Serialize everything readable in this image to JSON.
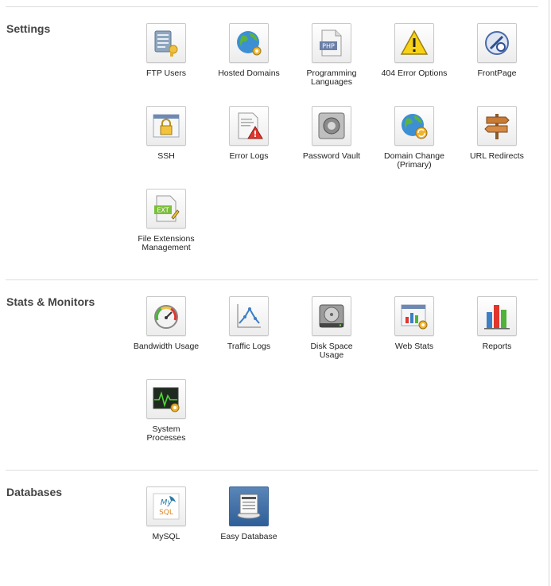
{
  "sections": [
    {
      "title": "Settings",
      "items": [
        {
          "label": "FTP Users",
          "icon": "ftp-users-icon"
        },
        {
          "label": "Hosted Domains",
          "icon": "hosted-domains-icon"
        },
        {
          "label": "Programming\nLanguages",
          "icon": "php-file-icon"
        },
        {
          "label": "404 Error Options",
          "icon": "warning-icon"
        },
        {
          "label": "FrontPage",
          "icon": "frontpage-icon"
        },
        {
          "label": "SSH",
          "icon": "ssh-lock-icon"
        },
        {
          "label": "Error Logs",
          "icon": "error-log-icon"
        },
        {
          "label": "Password Vault",
          "icon": "vault-icon"
        },
        {
          "label": "Domain Change\n(Primary)",
          "icon": "domain-change-icon"
        },
        {
          "label": "URL Redirects",
          "icon": "signpost-icon"
        },
        {
          "label": "File Extensions\nManagement",
          "icon": "file-extension-icon"
        }
      ]
    },
    {
      "title": "Stats & Monitors",
      "items": [
        {
          "label": "Bandwidth Usage",
          "icon": "gauge-icon"
        },
        {
          "label": "Traffic Logs",
          "icon": "traffic-chart-icon"
        },
        {
          "label": "Disk Space\nUsage",
          "icon": "hard-disk-icon"
        },
        {
          "label": "Web Stats",
          "icon": "web-stats-icon"
        },
        {
          "label": "Reports",
          "icon": "bar-chart-icon"
        },
        {
          "label": "System\nProcesses",
          "icon": "process-monitor-icon"
        }
      ]
    },
    {
      "title": "Databases",
      "items": [
        {
          "label": "MySQL",
          "icon": "mysql-icon"
        },
        {
          "label": "Easy Database",
          "icon": "easy-database-icon"
        }
      ]
    }
  ]
}
